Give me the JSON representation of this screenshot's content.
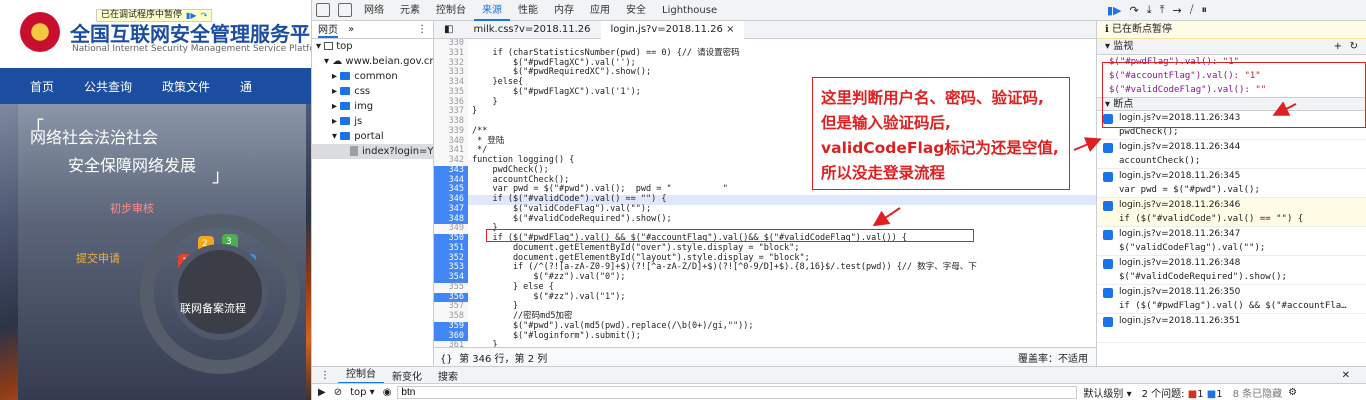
{
  "site": {
    "title": "全国互联网安全管理服务平",
    "subtitle": "National Internet Security Management Service Platfo",
    "debug_banner": "已在调试程序中暂停",
    "nav": [
      "首页",
      "公共查询",
      "政策文件",
      "通"
    ],
    "slogan_line1": "网络社会法治社会",
    "slogan_line2": "安全保障网络发展",
    "label_review": "初步审核",
    "label_submit": "提交申请",
    "flow_label": "联网备案流程",
    "seg_numbers": [
      "1",
      "2",
      "3",
      "4"
    ]
  },
  "devtools": {
    "tabs": [
      "网络",
      "元素",
      "控制台",
      "来源",
      "性能",
      "内存",
      "应用",
      "安全",
      "Lighthouse"
    ],
    "active_tab": "来源",
    "badges": {
      "errors": "3",
      "warnings": "1",
      "info": "1"
    },
    "navigator": {
      "tabs": [
        "网页",
        "»"
      ],
      "tree": [
        {
          "label": "top",
          "indent": 0,
          "type": "frame"
        },
        {
          "label": "www.beian.gov.cn",
          "indent": 1,
          "type": "cloud"
        },
        {
          "label": "common",
          "indent": 2,
          "type": "folder"
        },
        {
          "label": "css",
          "indent": 2,
          "type": "folder"
        },
        {
          "label": "img",
          "indent": 2,
          "type": "folder"
        },
        {
          "label": "js",
          "indent": 2,
          "type": "folder"
        },
        {
          "label": "portal",
          "indent": 2,
          "type": "folder"
        },
        {
          "label": "index?login=Y&t",
          "indent": 3,
          "type": "file",
          "selected": true
        }
      ]
    },
    "editor": {
      "tabs": [
        "milk.css?v=2018.11.26",
        "login.js?v=2018.11.26 ×"
      ],
      "active_tab_index": 1,
      "lines": [
        {
          "n": "330",
          "t": "",
          "bp": false
        },
        {
          "n": "331",
          "t": "    if (charStatisticsNumber(pwd) == 0) {// 请设置密码",
          "bp": false
        },
        {
          "n": "332",
          "t": "        $(\"#pwdFlagXC\").val('');",
          "bp": false
        },
        {
          "n": "333",
          "t": "        $(\"#pwdRequiredXC\").show();",
          "bp": false
        },
        {
          "n": "334",
          "t": "    }else{",
          "bp": false
        },
        {
          "n": "335",
          "t": "        $(\"#pwdFlagXC\").val('1');",
          "bp": false
        },
        {
          "n": "336",
          "t": "    }",
          "bp": false
        },
        {
          "n": "337",
          "t": "}",
          "bp": false
        },
        {
          "n": "338",
          "t": "",
          "bp": false
        },
        {
          "n": "339",
          "t": "/**",
          "bp": false
        },
        {
          "n": "340",
          "t": " * 登陆",
          "bp": false
        },
        {
          "n": "341",
          "t": " */",
          "bp": false
        },
        {
          "n": "342",
          "t": "function logging() {",
          "bp": false
        },
        {
          "n": "343",
          "t": "    pwdCheck();",
          "bp": true
        },
        {
          "n": "344",
          "t": "    accountCheck();",
          "bp": true
        },
        {
          "n": "345",
          "t": "    var pwd = $(\"#pwd\").val();  pwd = \"          \"",
          "bp": true
        },
        {
          "n": "346",
          "t": "    if ($(\"#validCode\").val() == \"\") {",
          "bp": true,
          "hl": true
        },
        {
          "n": "347",
          "t": "        $(\"validCodeFlag\").val(\"\");",
          "bp": true
        },
        {
          "n": "348",
          "t": "        $(\"#validCodeRequired\").show();",
          "bp": true
        },
        {
          "n": "349",
          "t": "    }",
          "bp": false
        },
        {
          "n": "350",
          "t": "    if ($(\"#pwdFlag\").val() && $(\"#accountFlag\").val()&& $(\"#validCodeFlag\").val()) {",
          "bp": true
        },
        {
          "n": "351",
          "t": "        document.getElementById(\"over\").style.display = \"block\";",
          "bp": true
        },
        {
          "n": "352",
          "t": "        document.getElementById(\"layout\").style.display = \"block\";",
          "bp": true
        },
        {
          "n": "353",
          "t": "        if (/^(?![a-zA-Z0-9]+$)(?![^a-zA-Z/D]+$)(?![^0-9/D]+$).{8,16}$/.test(pwd)) {// 数字、字母、下",
          "bp": true
        },
        {
          "n": "354",
          "t": "            $(\"#zz\").val(\"0\");",
          "bp": true
        },
        {
          "n": "355",
          "t": "        } else {",
          "bp": false
        },
        {
          "n": "356",
          "t": "            $(\"#zz\").val(\"1\");",
          "bp": true
        },
        {
          "n": "357",
          "t": "        }",
          "bp": false
        },
        {
          "n": "358",
          "t": "        //密码md5加密",
          "bp": false
        },
        {
          "n": "359",
          "t": "        $(\"#pwd\").val(md5(pwd).replace(/\\b(0+)/gi,\"\"));",
          "bp": true
        },
        {
          "n": "360",
          "t": "        $(\"#loginform\").submit();",
          "bp": true
        },
        {
          "n": "361",
          "t": "    }",
          "bp": false
        }
      ],
      "status_left": "第 346 行，第 2 列",
      "status_right": "覆盖率：不适用"
    },
    "debugger": {
      "paused": "已在断点暂停",
      "watch_title": "监视",
      "watch": [
        {
          "expr": "$(\"#pwdFlag\").val():",
          "value": "\"1\""
        },
        {
          "expr": "$(\"#accountFlag\").val():",
          "value": "\"1\""
        },
        {
          "expr": "$(\"#validCodeFlag\").val():",
          "value": "\"\""
        }
      ],
      "breakpoints_title": "断点",
      "breakpoints": [
        {
          "loc": "login.js?v=2018.11.26:343",
          "src": "pwdCheck();"
        },
        {
          "loc": "login.js?v=2018.11.26:344",
          "src": "accountCheck();"
        },
        {
          "loc": "login.js?v=2018.11.26:345",
          "src": "var pwd = $(\"#pwd\").val();"
        },
        {
          "loc": "login.js?v=2018.11.26:346",
          "src": "if ($(\"#validCode\").val() == \"\") {",
          "current": true
        },
        {
          "loc": "login.js?v=2018.11.26:347",
          "src": "$(\"validCodeFlag\").val(\"\");"
        },
        {
          "loc": "login.js?v=2018.11.26:348",
          "src": "$(\"#validCodeRequired\").show();"
        },
        {
          "loc": "login.js?v=2018.11.26:350",
          "src": "if ($(\"#pwdFlag\").val() && $(\"#accountFla…"
        },
        {
          "loc": "login.js?v=2018.11.26:351",
          "src": ""
        }
      ]
    },
    "drawer": {
      "tabs": [
        "控制台",
        "新变化",
        "搜索"
      ],
      "context": "top ▾",
      "filter_value": "btn",
      "level": "默认级别 ▾",
      "issues": "2 个问题:",
      "issue_err": "1",
      "issue_info": "1",
      "hidden": "8 条已隐藏"
    }
  },
  "annotation": {
    "lines": [
      "这里判断用户名、密码、验证码,",
      "但是输入验证码后,",
      "validCodeFlag标记为还是空值,",
      "所以没走登录流程"
    ]
  }
}
